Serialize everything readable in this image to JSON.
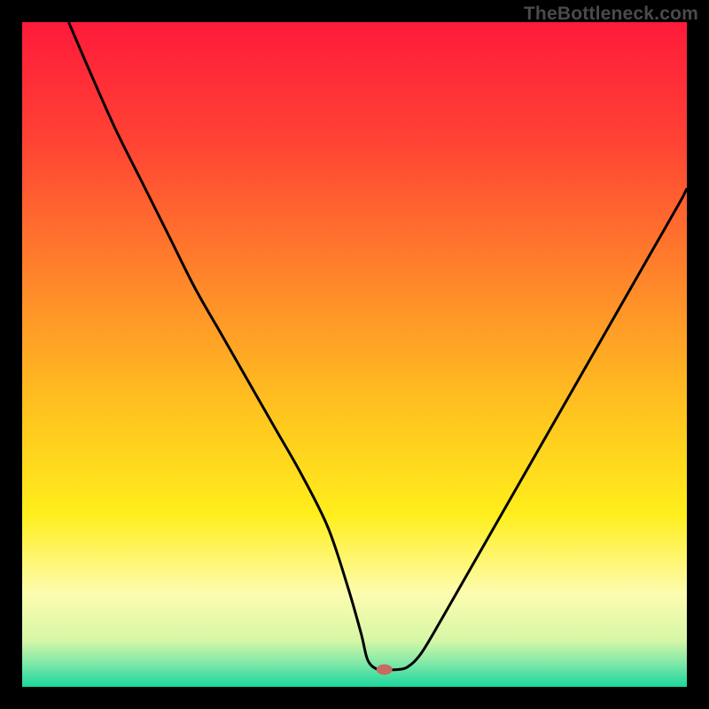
{
  "watermark": "TheBottleneck.com",
  "chart_data": {
    "type": "line",
    "title": "",
    "xlabel": "",
    "ylabel": "",
    "xlim": [
      0,
      100
    ],
    "ylim": [
      0,
      100
    ],
    "grid": false,
    "legend": false,
    "background_gradient_stops": [
      {
        "offset": 0.0,
        "color": "#ff1a3a"
      },
      {
        "offset": 0.18,
        "color": "#ff4334"
      },
      {
        "offset": 0.4,
        "color": "#ff8a2a"
      },
      {
        "offset": 0.58,
        "color": "#ffc21f"
      },
      {
        "offset": 0.74,
        "color": "#ffee1c"
      },
      {
        "offset": 0.86,
        "color": "#fdfcb0"
      },
      {
        "offset": 0.93,
        "color": "#d6f7a6"
      },
      {
        "offset": 0.965,
        "color": "#7fe8a8"
      },
      {
        "offset": 1.0,
        "color": "#1ad69d"
      }
    ],
    "series": [
      {
        "name": "bottleneck-curve",
        "color": "#000000",
        "x": [
          7,
          10,
          14,
          18,
          22,
          26,
          30,
          34,
          38,
          42,
          46,
          49,
          51,
          52,
          53.5,
          55,
          56.5,
          58,
          60,
          63,
          67,
          71,
          75,
          79,
          83,
          87,
          91,
          95,
          99,
          100
        ],
        "y": [
          100,
          93,
          84,
          76,
          68,
          60,
          53,
          46,
          39,
          32,
          24,
          15,
          8,
          4,
          2.6,
          2.6,
          2.6,
          3,
          5,
          10,
          17,
          24,
          31,
          38,
          45,
          52,
          59,
          66,
          73,
          75
        ]
      }
    ],
    "marker": {
      "name": "optimum-marker",
      "x": 54.5,
      "y": 2.6,
      "color": "#c76b62",
      "rx": 9,
      "ry": 6
    }
  }
}
